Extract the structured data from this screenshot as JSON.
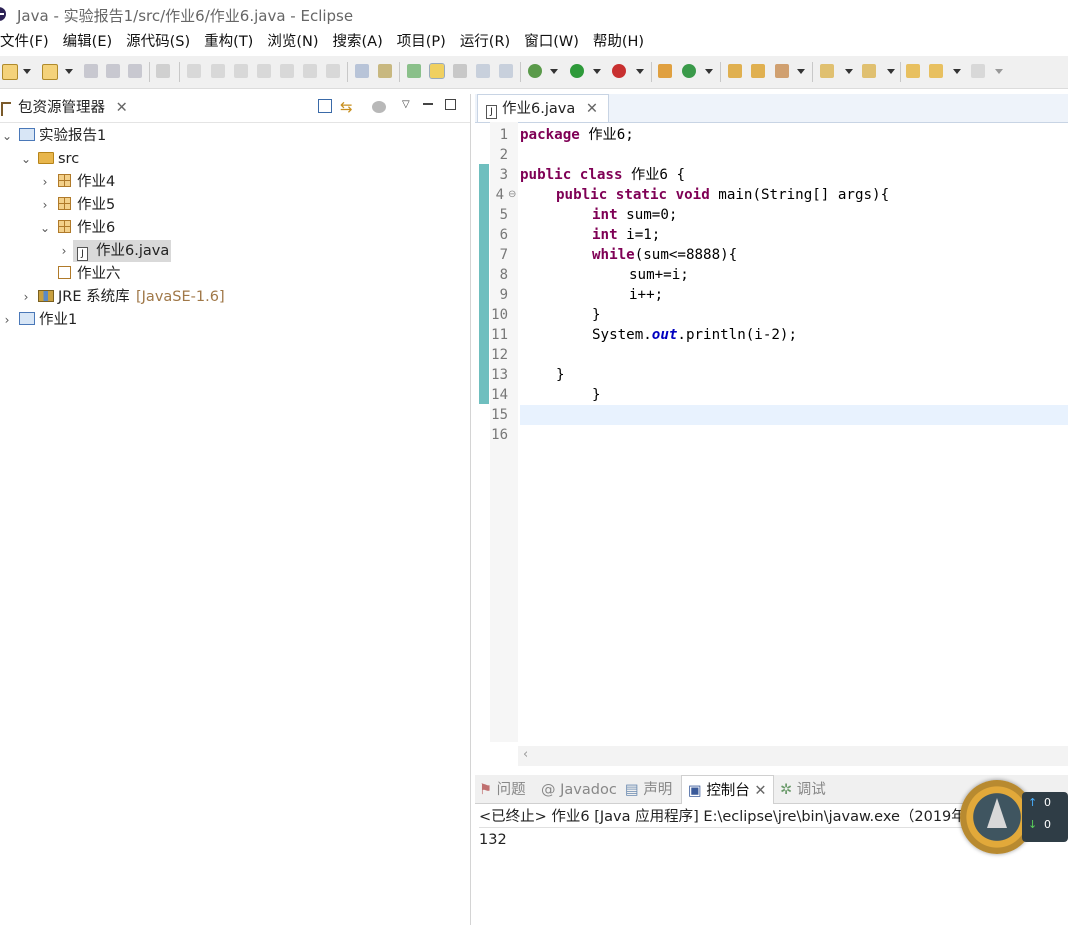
{
  "window": {
    "title": "Java  -  实验报告1/src/作业6/作业6.java  -  Eclipse"
  },
  "menu": [
    "文件(F)",
    "编辑(E)",
    "源代码(S)",
    "重构(T)",
    "浏览(N)",
    "搜索(A)",
    "项目(P)",
    "运行(R)",
    "窗口(W)",
    "帮助(H)"
  ],
  "package_explorer": {
    "tab_label": "包资源管理器",
    "tree": [
      {
        "label": "实验报告1",
        "extra": ""
      },
      {
        "label": "src",
        "extra": ""
      },
      {
        "label": "作业4",
        "extra": ""
      },
      {
        "label": "作业5",
        "extra": ""
      },
      {
        "label": "作业6",
        "extra": ""
      },
      {
        "label": "作业6.java",
        "extra": ""
      },
      {
        "label": "作业六",
        "extra": ""
      },
      {
        "label": "JRE 系统库",
        "extra": "[JavaSE-1.6]"
      },
      {
        "label": "作业1",
        "extra": ""
      }
    ]
  },
  "editor": {
    "tab_label": "作业6.java",
    "line_numbers": [
      "1",
      "2",
      "3",
      "4",
      "5",
      "6",
      "7",
      "8",
      "9",
      "10",
      "11",
      "12",
      "13",
      "14",
      "15",
      "16"
    ],
    "code": {
      "l1_kw": "package",
      "l1_rest": " 作业6;",
      "l3_kw1": "public",
      "l3_kw2": "class",
      "l3_rest": " 作业6 {",
      "l4_kw1": "public",
      "l4_kw2": "static",
      "l4_kw3": "void",
      "l4_rest": " main(String[] args){",
      "l5_kw": "int",
      "l5_rest": " sum=0;",
      "l6_kw": "int",
      "l6_rest": " i=1;",
      "l7_kw": "while",
      "l7_rest": "(sum<=8888){",
      "l8": "sum+=i;",
      "l9": "i++;",
      "l10": "}",
      "l11_a": "System.",
      "l11_field": "out",
      "l11_b": ".println(i-2);",
      "l13": "}",
      "l14": "}"
    }
  },
  "console": {
    "tabs": [
      "问题",
      "Javadoc",
      "声明",
      "控制台",
      "调试"
    ],
    "status_line": "<已终止> 作业6 [Java 应用程序] E:\\eclipse\\jre\\bin\\javaw.exe（2019年9月",
    "output": "132"
  },
  "widget": {
    "up_value": "0",
    "down_value": "0"
  }
}
